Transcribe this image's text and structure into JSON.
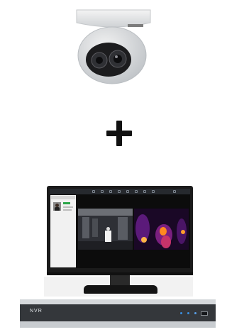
{
  "nvr": {
    "label": "NVR"
  },
  "colors": {
    "background": "#ffffff",
    "plus": "#111111",
    "thermal_hot": "#ff8a1f",
    "thermal_bg": "#1a0826",
    "face_match": "#2aa648"
  },
  "icons": [
    "thermal-turret-camera",
    "plus-icon",
    "monitor",
    "nvr-recorder"
  ]
}
